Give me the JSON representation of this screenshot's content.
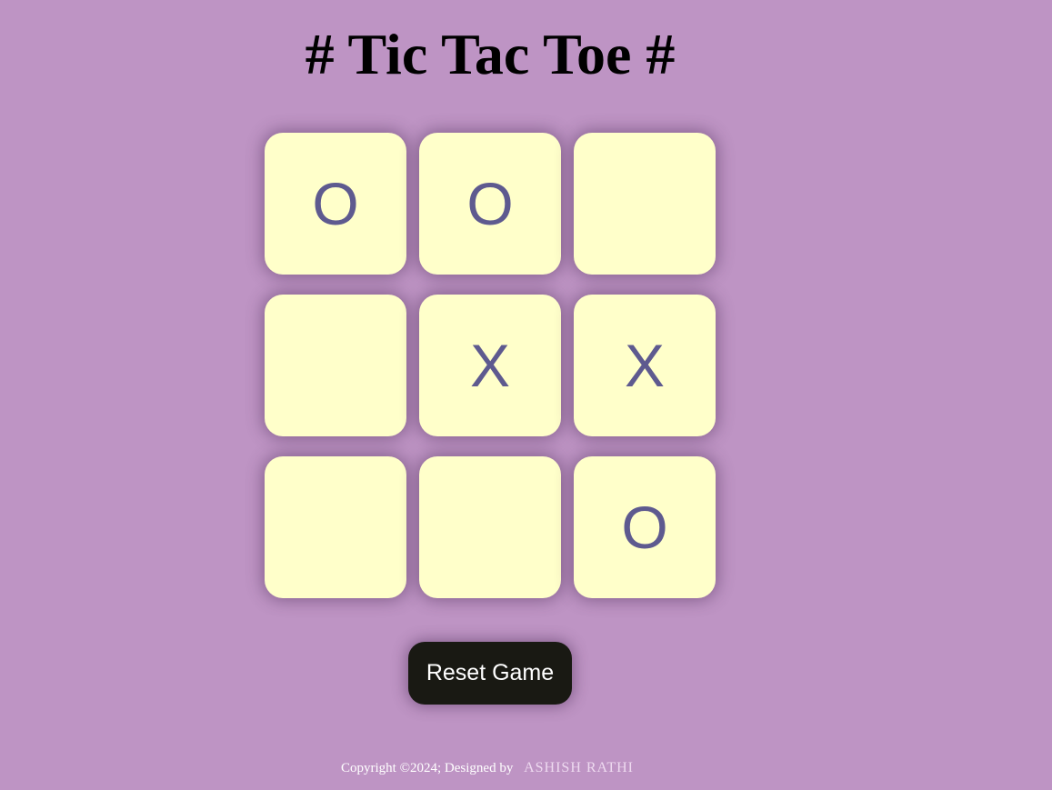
{
  "title": "# Tic Tac Toe #",
  "board": {
    "cells": [
      "O",
      "O",
      "",
      "",
      "X",
      "X",
      "",
      "",
      "O"
    ]
  },
  "reset_label": "Reset Game",
  "footer": {
    "copyright": "Copyright ©2024; Designed by",
    "author": "ASHISH RATHI"
  },
  "colors": {
    "background": "#be94c4",
    "cell": "#ffffca",
    "mark": "#5e5a8f",
    "button": "#191913"
  }
}
